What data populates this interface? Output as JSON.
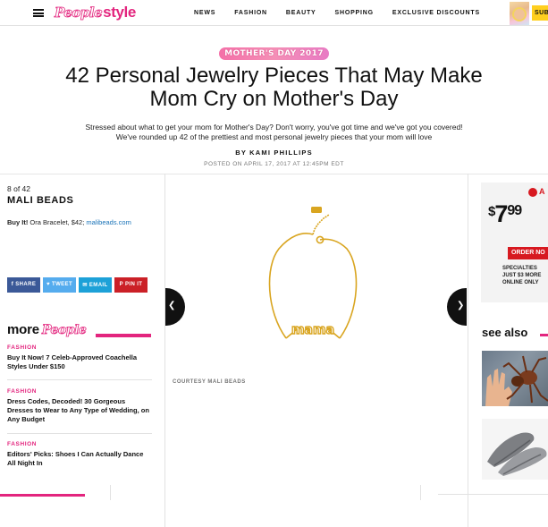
{
  "header": {
    "logo_people": "People",
    "logo_style": "style",
    "nav": [
      "NEWS",
      "FASHION",
      "BEAUTY",
      "SHOPPING",
      "EXCLUSIVE DISCOUNTS"
    ],
    "subscribe_label": "SUB"
  },
  "article": {
    "badge": "MOTHER'S DAY 2017",
    "headline_line1": "42 Personal Jewelry Pieces That May Make",
    "headline_line2": "Mom Cry on Mother's Day",
    "dek_line1": "Stressed about what to get your mom for Mother's Day? Don't worry, you've got time and we've got you covered!",
    "dek_line2": "We've rounded up 42 of the prettiest and most personal jewelry pieces that your mom will love",
    "byline": "BY KAMI PHILLIPS",
    "posted": "POSTED ON APRIL 17, 2017 AT 12:45PM EDT"
  },
  "slide": {
    "counter": "8 of 42",
    "title": "MALI BEADS",
    "buy_label": "Buy It!",
    "buy_text": " Ora Bracelet, $42; ",
    "buy_link": "malibeads.com",
    "pendant_text": "mama",
    "courtesy": "COURTESY MALI BEADS",
    "prev_icon": "chevron-left-icon",
    "next_icon": "chevron-right-icon"
  },
  "share": {
    "facebook": "f  SHARE",
    "twitter": "♥ TWEET",
    "email": "✉ EMAIL",
    "pinterest": "P PIN IT"
  },
  "more": {
    "word": "more",
    "brand": "People",
    "stories": [
      {
        "category": "FASHION",
        "title": "Buy It Now! 7 Celeb-Approved Coachella Styles Under $150"
      },
      {
        "category": "FASHION",
        "title": "Dress Codes, Decoded! 30 Gorgeous Dresses to Wear to Any Type of Wedding, on Any Budget"
      },
      {
        "category": "FASHION",
        "title": "Editors' Picks: Shoes I Can Actually Dance All Night In"
      }
    ]
  },
  "ad": {
    "brand": "A",
    "price": "7",
    "cents": "99",
    "order_label": "ORDER NO",
    "spec_line1": "SPECIALTIES",
    "spec_line2": "JUST $3 MORE",
    "spec_line3": "ONLINE ONLY"
  },
  "see_also": {
    "label": "see also"
  },
  "colors": {
    "brand_pink": "#e3257e",
    "link_blue": "#1a73b8",
    "gold": "#d9a520"
  }
}
